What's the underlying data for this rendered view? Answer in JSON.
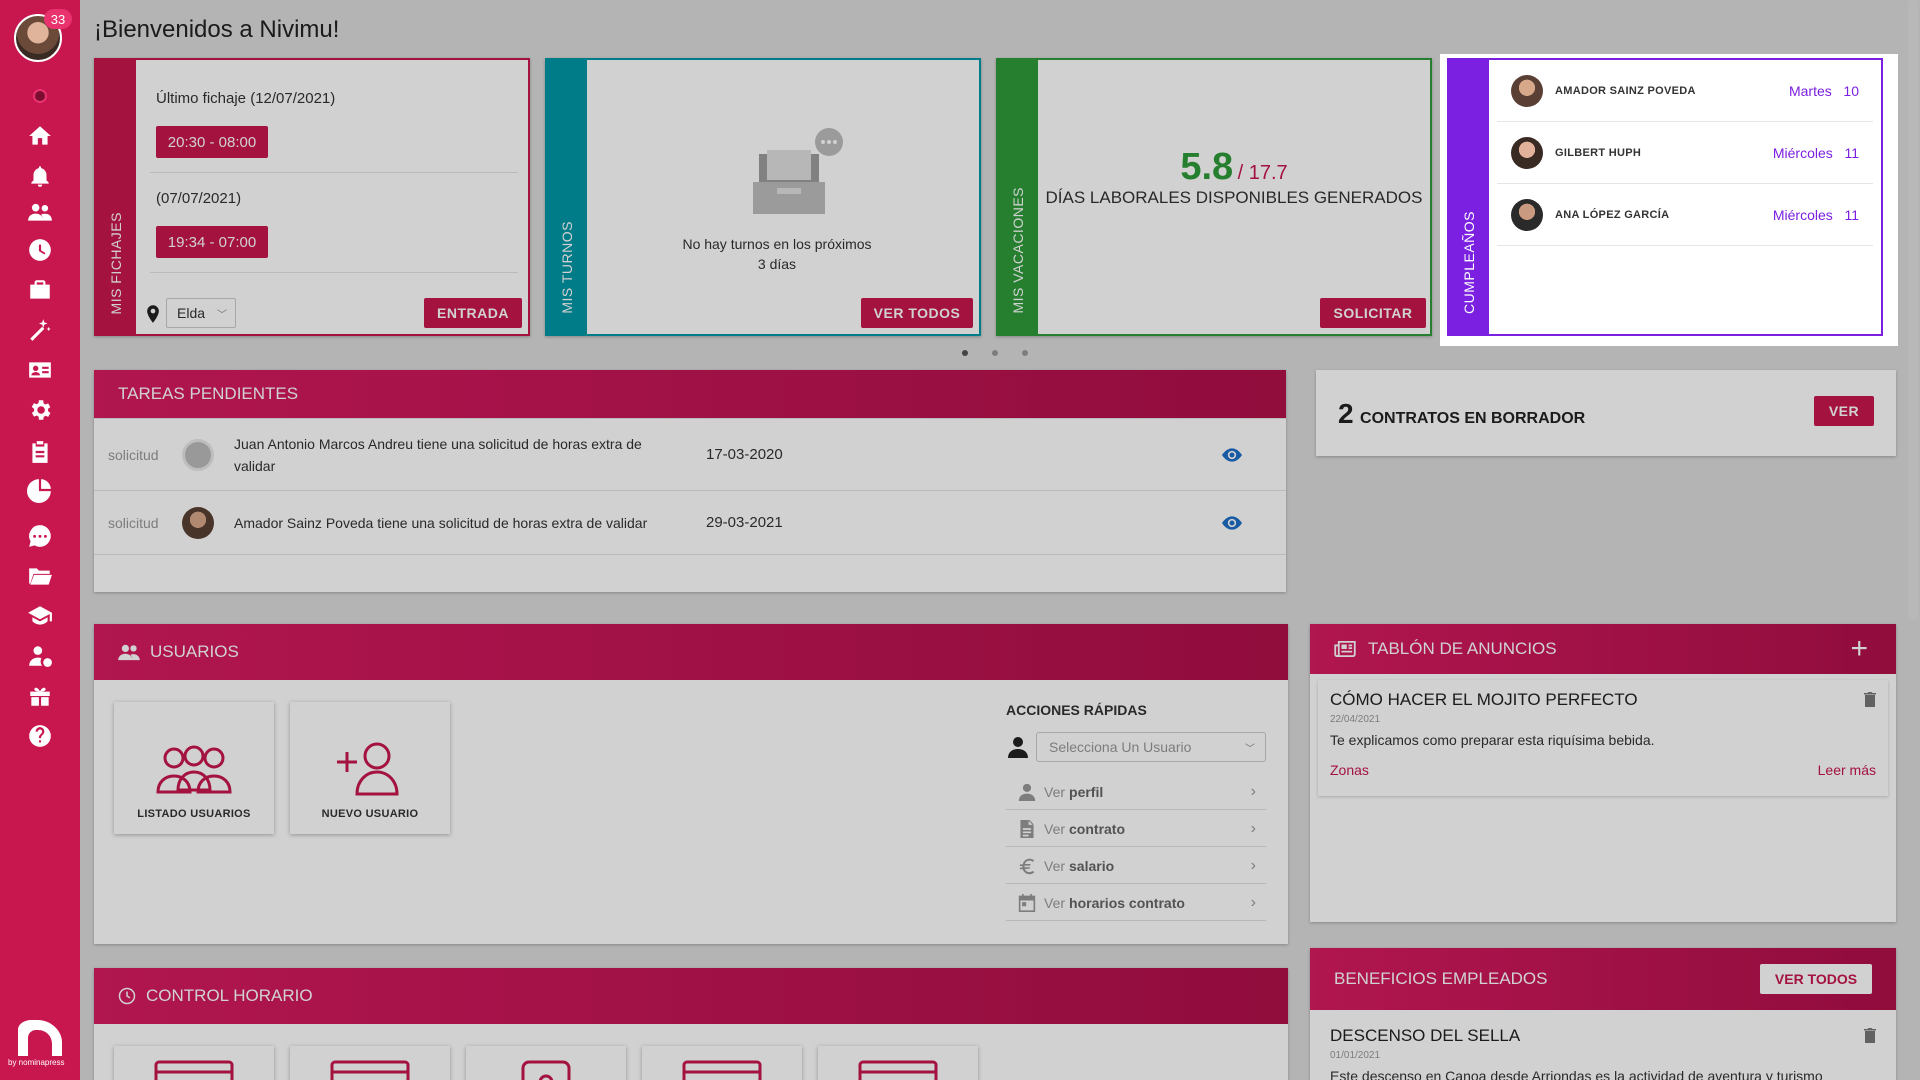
{
  "sidebar": {
    "badge": "33",
    "brand": "by nominapress",
    "icons": [
      "status-dot",
      "home-icon",
      "bell-icon",
      "users-icon",
      "clock-icon",
      "briefcase-icon",
      "magic-icon",
      "id-card-icon",
      "gear-icon",
      "clipboard-icon",
      "pie-chart-icon",
      "chat-icon",
      "folder-icon",
      "graduation-cap-icon",
      "user-money-icon",
      "gift-icon",
      "help-icon"
    ]
  },
  "page": {
    "title": "¡Bienvenidos a Nivimu!"
  },
  "fichajes": {
    "label": "MIS FICHAJES",
    "last_label": "Último fichaje (12/07/2021)",
    "time1": "20:30 - 08:00",
    "date2": "(07/07/2021)",
    "time2": "19:34 - 07:00",
    "location": "Elda",
    "button": "ENTRADA",
    "color": "#c8164f"
  },
  "turnos": {
    "label": "MIS TURNOS",
    "empty_text": "No hay turnos en los próximos 3 días",
    "button": "VER TODOS",
    "color": "#0097a7"
  },
  "vacaciones": {
    "label": "MIS VACACIONES",
    "available": "5.8",
    "total": "/ 17.7",
    "caption": "DÍAS LABORALES DISPONIBLES GENERADOS",
    "button": "SOLICITAR",
    "color": "#2e9b3a"
  },
  "cumpleanos": {
    "label": "CUMPLEAÑOS",
    "color": "#7b1fe0",
    "people": [
      {
        "name": "AMADOR SAINZ POVEDA",
        "day": "Martes",
        "num": "10"
      },
      {
        "name": "GILBERT HUPH",
        "day": "Miércoles",
        "num": "11"
      },
      {
        "name": "ANA LÓPEZ GARCÍA",
        "day": "Miércoles",
        "num": "11"
      }
    ]
  },
  "tareas": {
    "title": "TAREAS PENDIENTES",
    "rows": [
      {
        "type": "solicitud",
        "text": "Juan Antonio Marcos Andreu tiene una solicitud de horas extra de validar",
        "date": "17-03-2020"
      },
      {
        "type": "solicitud",
        "text": "Amador Sainz Poveda tiene una solicitud de horas extra de validar",
        "date": "29-03-2021"
      }
    ]
  },
  "contratos": {
    "count": "2",
    "label": "CONTRATOS EN BORRADOR",
    "button": "VER"
  },
  "usuarios": {
    "title": "USUARIOS",
    "tiles": [
      "LISTADO USUARIOS",
      "NUEVO USUARIO"
    ],
    "quick_title": "ACCIONES RÁPIDAS",
    "select_placeholder": "Selecciona Un Usuario",
    "actions": [
      {
        "prefix": "Ver",
        "bold": "perfil"
      },
      {
        "prefix": "Ver",
        "bold": "contrato"
      },
      {
        "prefix": "Ver",
        "bold": "salario"
      },
      {
        "prefix": "Ver",
        "bold": "horarios contrato"
      }
    ]
  },
  "tablon": {
    "title": "TABLÓN DE ANUNCIOS",
    "post_title": "CÓMO HACER EL MOJITO PERFECTO",
    "post_date": "22/04/2021",
    "post_text": "Te explicamos como preparar esta riquísima bebida.",
    "tag": "Zonas",
    "more": "Leer más"
  },
  "control": {
    "title": "CONTROL HORARIO"
  },
  "beneficios": {
    "title": "BENEFICIOS EMPLEADOS",
    "button": "VER TODOS",
    "post_title": "DESCENSO DEL SELLA",
    "post_date": "01/01/2021",
    "post_text": "Este descenso en Canoa desde Arriondas es la actividad de aventura y turismo"
  }
}
